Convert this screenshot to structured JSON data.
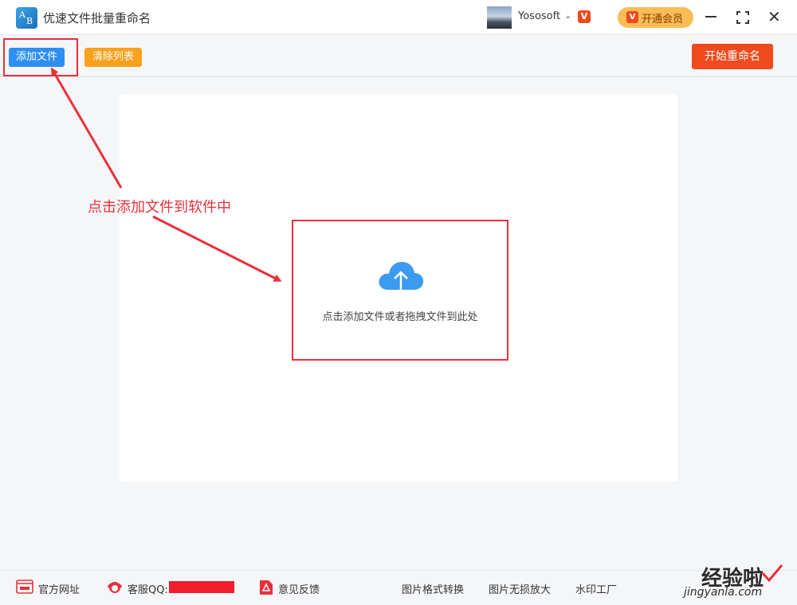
{
  "titlebar": {
    "app_title": "优速文件批量重命名",
    "logo_letters": [
      "A",
      "B"
    ],
    "username": "Yososoft",
    "vip_mark": "V",
    "vip_button": "开通会员"
  },
  "toolbar": {
    "add_files": "添加文件",
    "clear_list": "清除列表",
    "start_rename": "开始重命名"
  },
  "main": {
    "drop_hint": "点击添加文件或者拖拽文件到此处",
    "annotation": "点击添加文件到软件中"
  },
  "footer": {
    "website": "官方网址",
    "support_qq": "客服QQ:",
    "feedback": "意见反馈",
    "links": [
      "图片格式转换",
      "图片无损放大",
      "水印工厂"
    ]
  },
  "watermark": {
    "text": "经验啦",
    "url": "jingyanla.com"
  },
  "colors": {
    "primary_blue": "#2e8ff0",
    "clear_orange": "#f9a11b",
    "start_red": "#f04a1e",
    "highlight_red": "#e9303a",
    "vip_gold": "#f8bd55",
    "cloud_blue": "#3a9bf0"
  },
  "icons": {
    "logo": "ab-logo-icon",
    "upload": "cloud-upload-icon",
    "website": "web-icon",
    "support": "support-icon",
    "feedback": "pdf-feedback-icon",
    "minimize": "minimize-icon",
    "maximize": "maximize-icon",
    "close": "close-icon"
  }
}
